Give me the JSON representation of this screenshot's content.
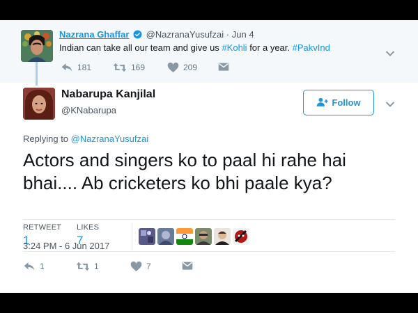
{
  "parent_tweet": {
    "display_name": "Nazrana Ghaffar",
    "handle": "@NazranaYusufzai",
    "separator": "·",
    "date": "Jun 4",
    "text_before": "Indian can take all our team and give us ",
    "hashtag_1": "#Kohli",
    "text_middle": " for a year. ",
    "hashtag_2": "#PakvInd",
    "reply_count": "181",
    "retweet_count": "169",
    "like_count": "209",
    "icons": [
      "verified-badge-icon",
      "reply-icon",
      "retweet-icon",
      "heart-icon",
      "dm-icon",
      "chevron-down-icon"
    ]
  },
  "main_tweet": {
    "display_name": "Nabarupa Kanjilal",
    "handle": "@KNabarupa",
    "follow_label": "Follow",
    "replying_prefix": "Replying to ",
    "replying_handle": "@NazranaYusufzai",
    "text": "Actors and singers ko to paal hi rahe hai bhai.... Ab cricketers ko bhi paale kya?",
    "retweet_label": "RETWEET",
    "retweet_value": "1",
    "likes_label": "LIKES",
    "likes_value": "7",
    "timestamp": "3:24 PM - 6 Jun 2017",
    "reply_count": "1",
    "retweet_count": "1",
    "like_count": "7",
    "icons": [
      "follow-user-icon",
      "chevron-down-icon",
      "reply-icon",
      "retweet-icon",
      "heart-icon",
      "dm-icon"
    ]
  },
  "colors": {
    "accent": "#1b95e0",
    "parent_background": "#f5f8fa",
    "thread_line": "#a3d0ef",
    "muted_text": "#657786"
  }
}
